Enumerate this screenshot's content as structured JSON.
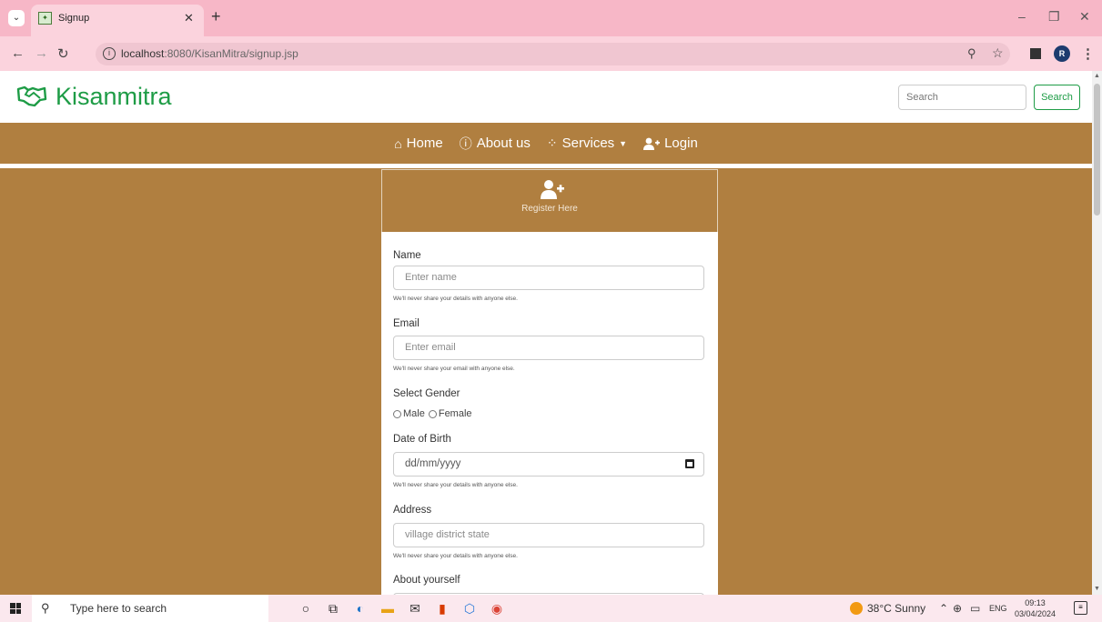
{
  "browser": {
    "tab_title": "Signup",
    "url_host": "localhost",
    "url_path": ":8080/KisanMitra/signup.jsp",
    "profile_initial": "R"
  },
  "header": {
    "brand": "Kisanmitra",
    "search_placeholder": "Search",
    "search_button": "Search",
    "brand_color": "#1e9c46"
  },
  "nav": {
    "items": [
      {
        "label": "Home",
        "icon": "home-icon"
      },
      {
        "label": "About us",
        "icon": "info-icon"
      },
      {
        "label": "Services",
        "icon": "spinner-icon"
      },
      {
        "label": "Login",
        "icon": "user-plus-icon"
      }
    ],
    "bg_color": "#b07f40"
  },
  "form": {
    "title": "Register Here",
    "name_label": "Name",
    "name_placeholder": "Enter name",
    "name_help": "We'll never share your details with anyone else.",
    "email_label": "Email",
    "email_placeholder": "Enter email",
    "email_help": "We'll never share your email with anyone else.",
    "gender_label": "Select Gender",
    "gender_male": "Male",
    "gender_female": "Female",
    "dob_label": "Date of Birth",
    "dob_placeholder": "dd/mm/yyyy",
    "dob_help": "We'll never share your details with anyone else.",
    "address_label": "Address",
    "address_placeholder": "village district state",
    "address_help": "We'll never share your details with anyone else.",
    "about_label": "About yourself"
  },
  "taskbar": {
    "search_placeholder": "Type here to search",
    "weather": "38°C  Sunny",
    "lang": "ENG",
    "time": "09:13",
    "date": "03/04/2024"
  }
}
